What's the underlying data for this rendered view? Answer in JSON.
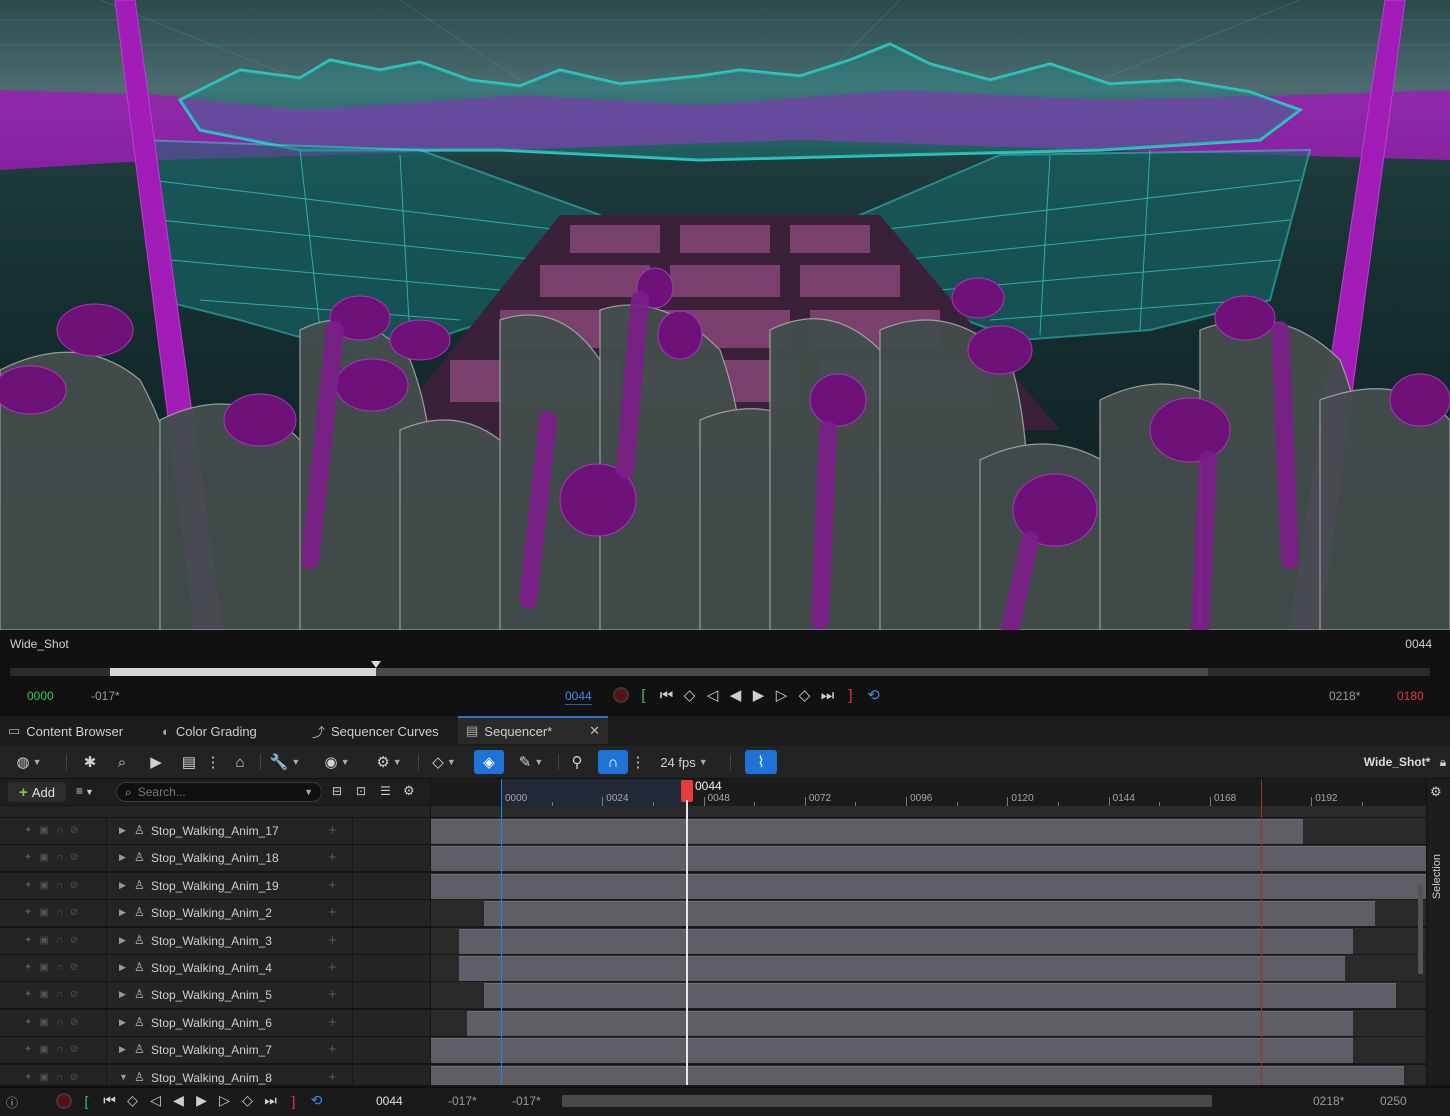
{
  "viewport": {
    "shot_name": "Wide_Shot",
    "current_frame": "0044"
  },
  "transport": {
    "start_green": "0000",
    "start_offset": "-017*",
    "current_frame": "0044",
    "end_offset": "0218*",
    "end_red": "0180",
    "progress_fraction": 0.188
  },
  "tabs": [
    {
      "label": "Content Browser",
      "icon": "folder-icon"
    },
    {
      "label": "Color Grading",
      "icon": "palette-icon"
    },
    {
      "label": "Sequencer Curves",
      "icon": "curve-icon"
    },
    {
      "label": "Sequencer*",
      "icon": "clapper-icon",
      "active": true
    }
  ],
  "toolbar": {
    "fps_label": "24 fps",
    "sequence_name": "Wide_Shot*"
  },
  "outliner": {
    "add_label": "Add",
    "search_placeholder": "Search..."
  },
  "ruler": {
    "playhead_label": "0044",
    "ticks": [
      "0000",
      "0024",
      "0048",
      "0072",
      "0096",
      "0120",
      "0144",
      "0168",
      "0192"
    ]
  },
  "side_tab": "Selection",
  "tracks": [
    {
      "name": "Stop_Walking_Anim_17",
      "start": -28,
      "end": 190
    },
    {
      "name": "Stop_Walking_Anim_18",
      "start": -32,
      "end": 250
    },
    {
      "name": "Stop_Walking_Anim_19",
      "start": -30,
      "end": 250
    },
    {
      "name": "Stop_Walking_Anim_2",
      "start": -4,
      "end": 207
    },
    {
      "name": "Stop_Walking_Anim_3",
      "start": -10,
      "end": 202
    },
    {
      "name": "Stop_Walking_Anim_4",
      "start": -10,
      "end": 200
    },
    {
      "name": "Stop_Walking_Anim_5",
      "start": -4,
      "end": 212
    },
    {
      "name": "Stop_Walking_Anim_6",
      "start": -8,
      "end": 202
    },
    {
      "name": "Stop_Walking_Anim_7",
      "start": -32,
      "end": 202
    },
    {
      "name": "Stop_Walking_Anim_8",
      "start": -32,
      "end": 214
    }
  ],
  "bottom": {
    "current_frame": "0044",
    "view_start": "-017*",
    "work_start": "-017*",
    "work_end": "0218*",
    "view_end": "0250"
  },
  "colors": {
    "accent": "#1f72d6",
    "playhead": "#e63c3c",
    "start_marker": "#34c759",
    "end_marker": "#e33b3b",
    "wireframe_cyan": "#2ec9c4",
    "wireframe_magenta": "#b022c8"
  }
}
